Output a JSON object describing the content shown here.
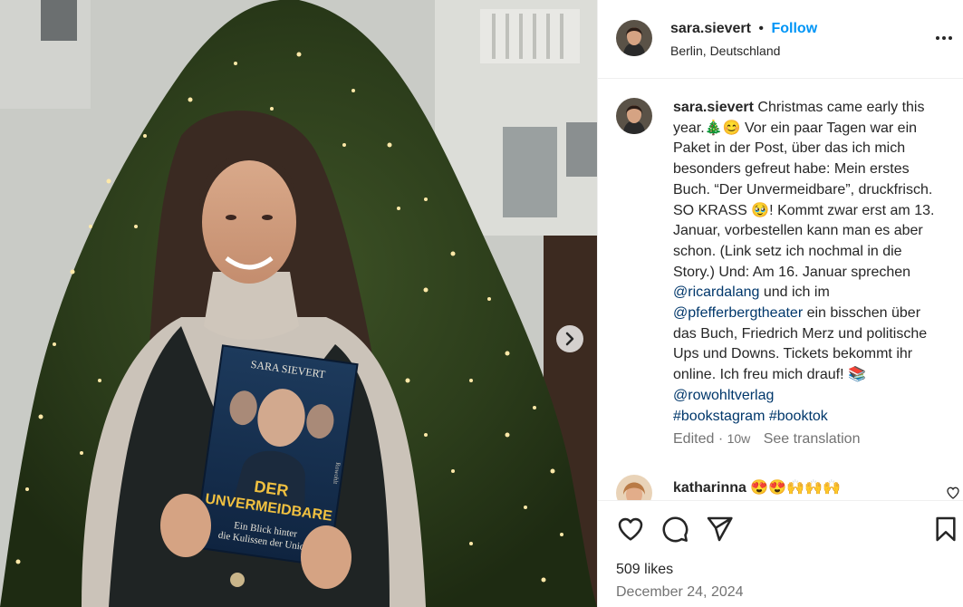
{
  "post": {
    "username": "sara.sievert",
    "dot": "•",
    "follow_label": "Follow",
    "location": "Berlin, Deutschland",
    "more_icon": "more-horizontal-icon"
  },
  "photo": {
    "book": {
      "author": "SARA SIEVERT",
      "title_line1": "DER",
      "title_line2": "UNVERMEIDBARE",
      "subtitle_line1": "Ein Blick hinter",
      "subtitle_line2": "die Kulissen der Union",
      "publisher": "Rowohlt"
    },
    "next_icon": "chevron-right-icon"
  },
  "caption": {
    "username": "sara.sievert",
    "text_1": " Christmas came early this year.🎄😊 Vor ein paar Tagen war ein Paket in der Post, über das ich mich besonders gefreut habe: Mein erstes Buch. “Der Unvermeidbare”, druckfrisch. SO KRASS 🥹! Kommt zwar erst am 13. Januar, vorbestellen kann man es aber schon. (Link setz ich nochmal in die Story.) Und: Am 16. Januar sprechen ",
    "mention_1": "@ricardalang",
    "text_2": " und ich im ",
    "mention_2": "@pfefferbergtheater",
    "text_3": " ein bisschen über das Buch, Friedrich Merz und politische Ups und Downs. Tickets bekommt ihr online. Ich freu mich drauf! 📚 ",
    "mention_3": "@rowohltverlag",
    "hashtag_1": "#bookstagram",
    "hashtag_2": "#booktok"
  },
  "meta": {
    "edited": "Edited",
    "sep": " · ",
    "time": "10w",
    "see_translation": "See translation"
  },
  "comment": {
    "username": "katharinna",
    "text": "😍😍🙌🙌🙌"
  },
  "actions": {
    "like_icon": "heart-icon",
    "comment_icon": "comment-icon",
    "share_icon": "share-icon",
    "save_icon": "bookmark-icon"
  },
  "likes": "509 likes",
  "date": "December 24, 2024",
  "colors": {
    "link": "#00376b",
    "follow": "#0095f6",
    "muted": "#737373"
  }
}
